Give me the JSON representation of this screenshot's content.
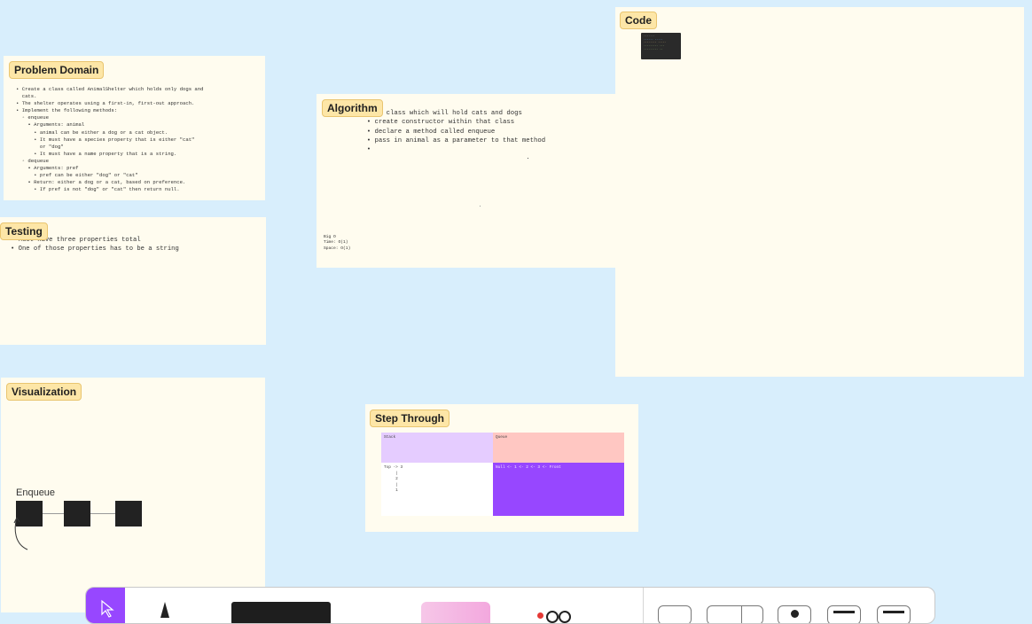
{
  "frames": {
    "problem_domain": {
      "label": "Problem Domain",
      "lines": [
        "• Create a class called AnimalShelter which holds only dogs and",
        "  cats.",
        "• The shelter operates using a first-in, first-out approach.",
        "• Implement the following methods:",
        "  ◦ enqueue",
        "    ▪ Arguments: animal",
        "      • animal can be either a dog or a cat object.",
        "      • It must have a species property that is either \"cat\"",
        "        or \"dog\"",
        "      • It must have a name property that is a string.",
        "  ◦ dequeue",
        "    ▪ Arguments: pref",
        "      • pref can be either \"dog\" or \"cat\"",
        "    ▪ Return: either a dog or a cat, based on preference.",
        "      • If pref is not \"dog\" or \"cat\" then return null."
      ]
    },
    "testing": {
      "label": "Testing",
      "lines": [
        "• Must have three properties total",
        "• One of those properties has to be a string"
      ]
    },
    "algorithm": {
      "label": "Algorithm",
      "lines": [
        "Animal class which will hold cats and dogs",
        "  • create constructor within that class",
        "  • declare a method called enqueue",
        "  • pass in animal as a parameter to that method",
        "  •"
      ],
      "big_o": [
        "Big O",
        "Time: O(1)",
        "Space: O(1)"
      ]
    },
    "code": {
      "label": "Code"
    },
    "visualization": {
      "label": "Visualization",
      "title": "Enqueue"
    },
    "step_through": {
      "label": "Step Through",
      "stack_header": "Stack",
      "queue_header": "Queue",
      "stack_lines": [
        "Top -> 3",
        "     |",
        "     2",
        "     |",
        "     1"
      ],
      "queue_line": "Null <- 1 <- 2 <- 3 <- Front"
    }
  },
  "colors": {
    "canvas": "#d8eefc",
    "frame": "#fffcef",
    "label": "#fde6a7",
    "stack_header": "#e5ccff",
    "queue_header": "#ffc7c2",
    "queue_body": "#9747ff",
    "toolbar_active": "#9747ff"
  },
  "toolbar": {
    "tools": [
      "move-tool",
      "pen-tool",
      "text-tool",
      "sticky-tool",
      "shapes-tool",
      "stamp-tool",
      "comment-tool",
      "widget-tool",
      "table-tool",
      "section-tool"
    ]
  }
}
